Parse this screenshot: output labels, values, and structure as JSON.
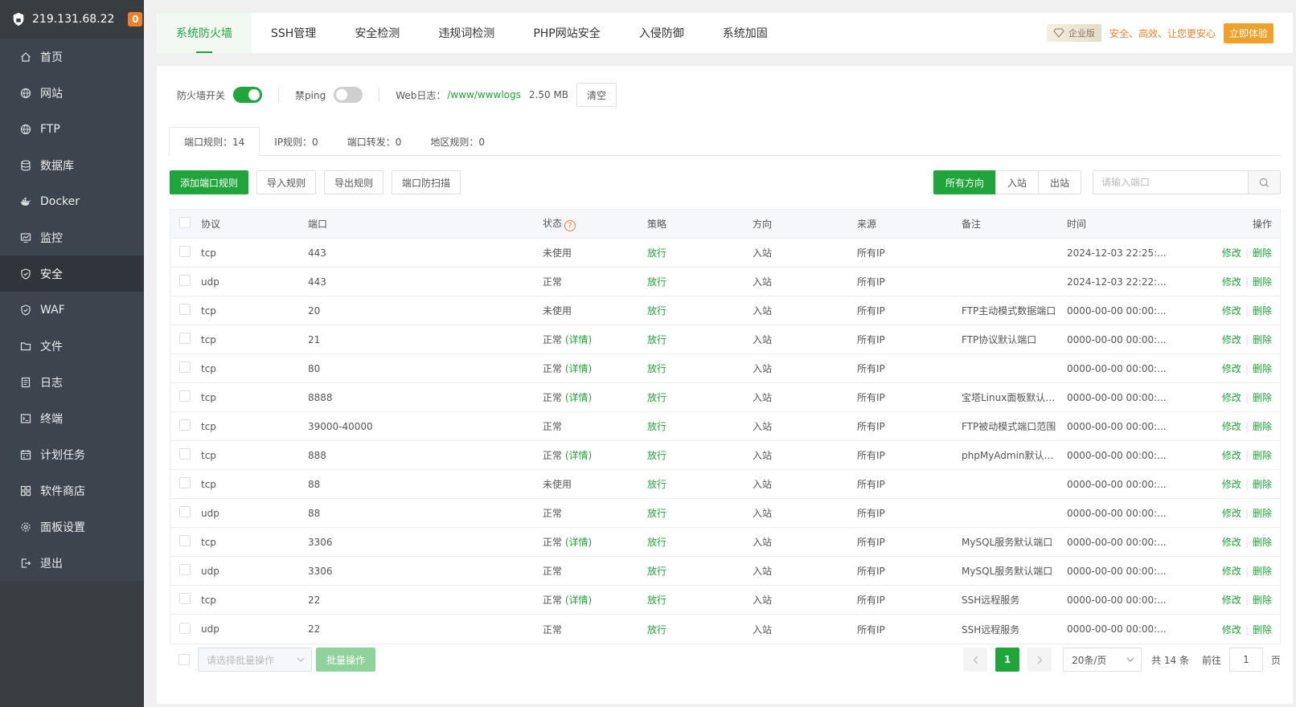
{
  "sidebar": {
    "ip": "219.131.68.22",
    "badge": "0",
    "items": [
      {
        "label": "首页",
        "icon": "home-icon"
      },
      {
        "label": "网站",
        "icon": "globe-icon"
      },
      {
        "label": "FTP",
        "icon": "globe-icon"
      },
      {
        "label": "数据库",
        "icon": "database-icon"
      },
      {
        "label": "Docker",
        "icon": "docker-icon"
      },
      {
        "label": "监控",
        "icon": "monitor-icon"
      },
      {
        "label": "安全",
        "icon": "shield-icon"
      },
      {
        "label": "WAF",
        "icon": "shield-icon"
      },
      {
        "label": "文件",
        "icon": "folder-icon"
      },
      {
        "label": "日志",
        "icon": "log-icon"
      },
      {
        "label": "终端",
        "icon": "terminal-icon"
      },
      {
        "label": "计划任务",
        "icon": "calendar-icon"
      },
      {
        "label": "软件商店",
        "icon": "apps-icon"
      },
      {
        "label": "面板设置",
        "icon": "gear-icon"
      },
      {
        "label": "退出",
        "icon": "logout-icon"
      }
    ],
    "active_index": 6
  },
  "topbar": {
    "tabs": [
      "系统防火墙",
      "SSH管理",
      "安全检测",
      "违规词检测",
      "PHP网站安全",
      "入侵防御",
      "系统加固"
    ],
    "enterprise_tag": "企业版",
    "enterprise_text": "安全、高效、让您更安心",
    "try_button": "立即体验"
  },
  "status": {
    "firewall_label": "防火墙开关",
    "firewall_on": true,
    "ping_label": "禁ping",
    "ping_on": false,
    "weblog_label": "Web日志：",
    "weblog_path": "/www/wwwlogs",
    "weblog_size": "2.50 MB",
    "clear_button": "清空"
  },
  "subtabs": [
    "端口规则：14",
    "IP规则：0",
    "端口转发：0",
    "地区规则：0"
  ],
  "actions": {
    "add": "添加端口规则",
    "import": "导入规则",
    "export": "导出规则",
    "scan": "端口防扫描",
    "directions": [
      "所有方向",
      "入站",
      "出站"
    ],
    "search_placeholder": "请输入端口"
  },
  "table": {
    "headers": [
      "协议",
      "端口",
      "状态",
      "策略",
      "方向",
      "来源",
      "备注",
      "时间",
      "操作"
    ],
    "detail_label": "(详情)",
    "edit_label": "修改",
    "delete_label": "删除",
    "rows": [
      {
        "proto": "tcp",
        "port": "443",
        "state": "未使用",
        "detail": false,
        "policy": "放行",
        "dir": "入站",
        "src": "所有IP",
        "note": "",
        "time": "2024-12-03 22:25:..."
      },
      {
        "proto": "udp",
        "port": "443",
        "state": "正常",
        "detail": false,
        "policy": "放行",
        "dir": "入站",
        "src": "所有IP",
        "note": "",
        "time": "2024-12-03 22:22:..."
      },
      {
        "proto": "tcp",
        "port": "20",
        "state": "未使用",
        "detail": false,
        "policy": "放行",
        "dir": "入站",
        "src": "所有IP",
        "note": "FTP主动模式数据端口",
        "time": "0000-00-00 00:00:..."
      },
      {
        "proto": "tcp",
        "port": "21",
        "state": "正常",
        "detail": true,
        "policy": "放行",
        "dir": "入站",
        "src": "所有IP",
        "note": "FTP协议默认端口",
        "time": "0000-00-00 00:00:..."
      },
      {
        "proto": "tcp",
        "port": "80",
        "state": "正常",
        "detail": true,
        "policy": "放行",
        "dir": "入站",
        "src": "所有IP",
        "note": "",
        "time": "0000-00-00 00:00:..."
      },
      {
        "proto": "tcp",
        "port": "8888",
        "state": "正常",
        "detail": true,
        "policy": "放行",
        "dir": "入站",
        "src": "所有IP",
        "note": "宝塔Linux面板默认端口",
        "time": "0000-00-00 00:00:..."
      },
      {
        "proto": "tcp",
        "port": "39000-40000",
        "state": "正常",
        "detail": false,
        "policy": "放行",
        "dir": "入站",
        "src": "所有IP",
        "note": "FTP被动模式端口范围",
        "time": "0000-00-00 00:00:..."
      },
      {
        "proto": "tcp",
        "port": "888",
        "state": "正常",
        "detail": true,
        "policy": "放行",
        "dir": "入站",
        "src": "所有IP",
        "note": "phpMyAdmin默认端口",
        "time": "0000-00-00 00:00:..."
      },
      {
        "proto": "tcp",
        "port": "88",
        "state": "未使用",
        "detail": false,
        "policy": "放行",
        "dir": "入站",
        "src": "所有IP",
        "note": "",
        "time": "0000-00-00 00:00:..."
      },
      {
        "proto": "udp",
        "port": "88",
        "state": "正常",
        "detail": false,
        "policy": "放行",
        "dir": "入站",
        "src": "所有IP",
        "note": "",
        "time": "0000-00-00 00:00:..."
      },
      {
        "proto": "tcp",
        "port": "3306",
        "state": "正常",
        "detail": true,
        "policy": "放行",
        "dir": "入站",
        "src": "所有IP",
        "note": "MySQL服务默认端口",
        "time": "0000-00-00 00:00:..."
      },
      {
        "proto": "udp",
        "port": "3306",
        "state": "正常",
        "detail": false,
        "policy": "放行",
        "dir": "入站",
        "src": "所有IP",
        "note": "MySQL服务默认端口",
        "time": "0000-00-00 00:00:..."
      },
      {
        "proto": "tcp",
        "port": "22",
        "state": "正常",
        "detail": true,
        "policy": "放行",
        "dir": "入站",
        "src": "所有IP",
        "note": "SSH远程服务",
        "time": "0000-00-00 00:00:..."
      },
      {
        "proto": "udp",
        "port": "22",
        "state": "正常",
        "detail": false,
        "policy": "放行",
        "dir": "入站",
        "src": "所有IP",
        "note": "SSH远程服务",
        "time": "0000-00-00 00:00:..."
      }
    ]
  },
  "footer": {
    "batch_placeholder": "请选择批量操作",
    "batch_button": "批量操作",
    "current_page": "1",
    "page_size": "20条/页",
    "total": "共 14 条",
    "goto_label": "前往",
    "goto_value": "1",
    "page_unit": "页"
  },
  "colors": {
    "accent": "#20a53a",
    "sidebar": "#3c444d",
    "orange": "#f0812a"
  }
}
